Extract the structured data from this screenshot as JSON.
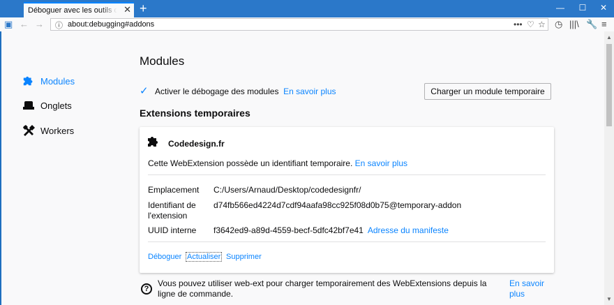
{
  "browser": {
    "tab_title": "Déboguer avec les outils de développement",
    "url": "about:debugging#addons",
    "colors": {
      "accent": "#0a84ff",
      "chrome": "#2b78c9"
    }
  },
  "sidebar": {
    "items": [
      {
        "label": "Modules",
        "icon": "puzzle-icon",
        "active": true
      },
      {
        "label": "Onglets",
        "icon": "tab-icon",
        "active": false
      },
      {
        "label": "Workers",
        "icon": "tools-icon",
        "active": false
      }
    ]
  },
  "main": {
    "title": "Modules",
    "enable_checkbox_label": "Activer le débogage des modules",
    "enable_checked": true,
    "learn_more": "En savoir plus",
    "load_button": "Charger un module temporaire",
    "section_title": "Extensions temporaires"
  },
  "extension": {
    "name": "Codedesign.fr",
    "message": "Cette WebExtension possède un identifiant temporaire.",
    "message_link": "En savoir plus",
    "rows": [
      {
        "label": "Emplacement",
        "value": "C:/Users/Arnaud/Desktop/codedesignfr/"
      },
      {
        "label": "Identifiant de l'extension",
        "value": "d74fb566ed4224d7cdf94aafa98cc925f08d0b75@temporary-addon"
      },
      {
        "label": "UUID interne",
        "value": "f3642ed9-a89d-4559-becf-5dfc42bf7e41",
        "link": "Adresse du manifeste"
      }
    ],
    "actions": {
      "debug": "Déboguer",
      "reload": "Actualiser",
      "remove": "Supprimer"
    }
  },
  "footer": {
    "text": "Vous pouvez utiliser web-ext pour charger temporairement des WebExtensions depuis la ligne de commande.",
    "link": "En savoir plus"
  }
}
